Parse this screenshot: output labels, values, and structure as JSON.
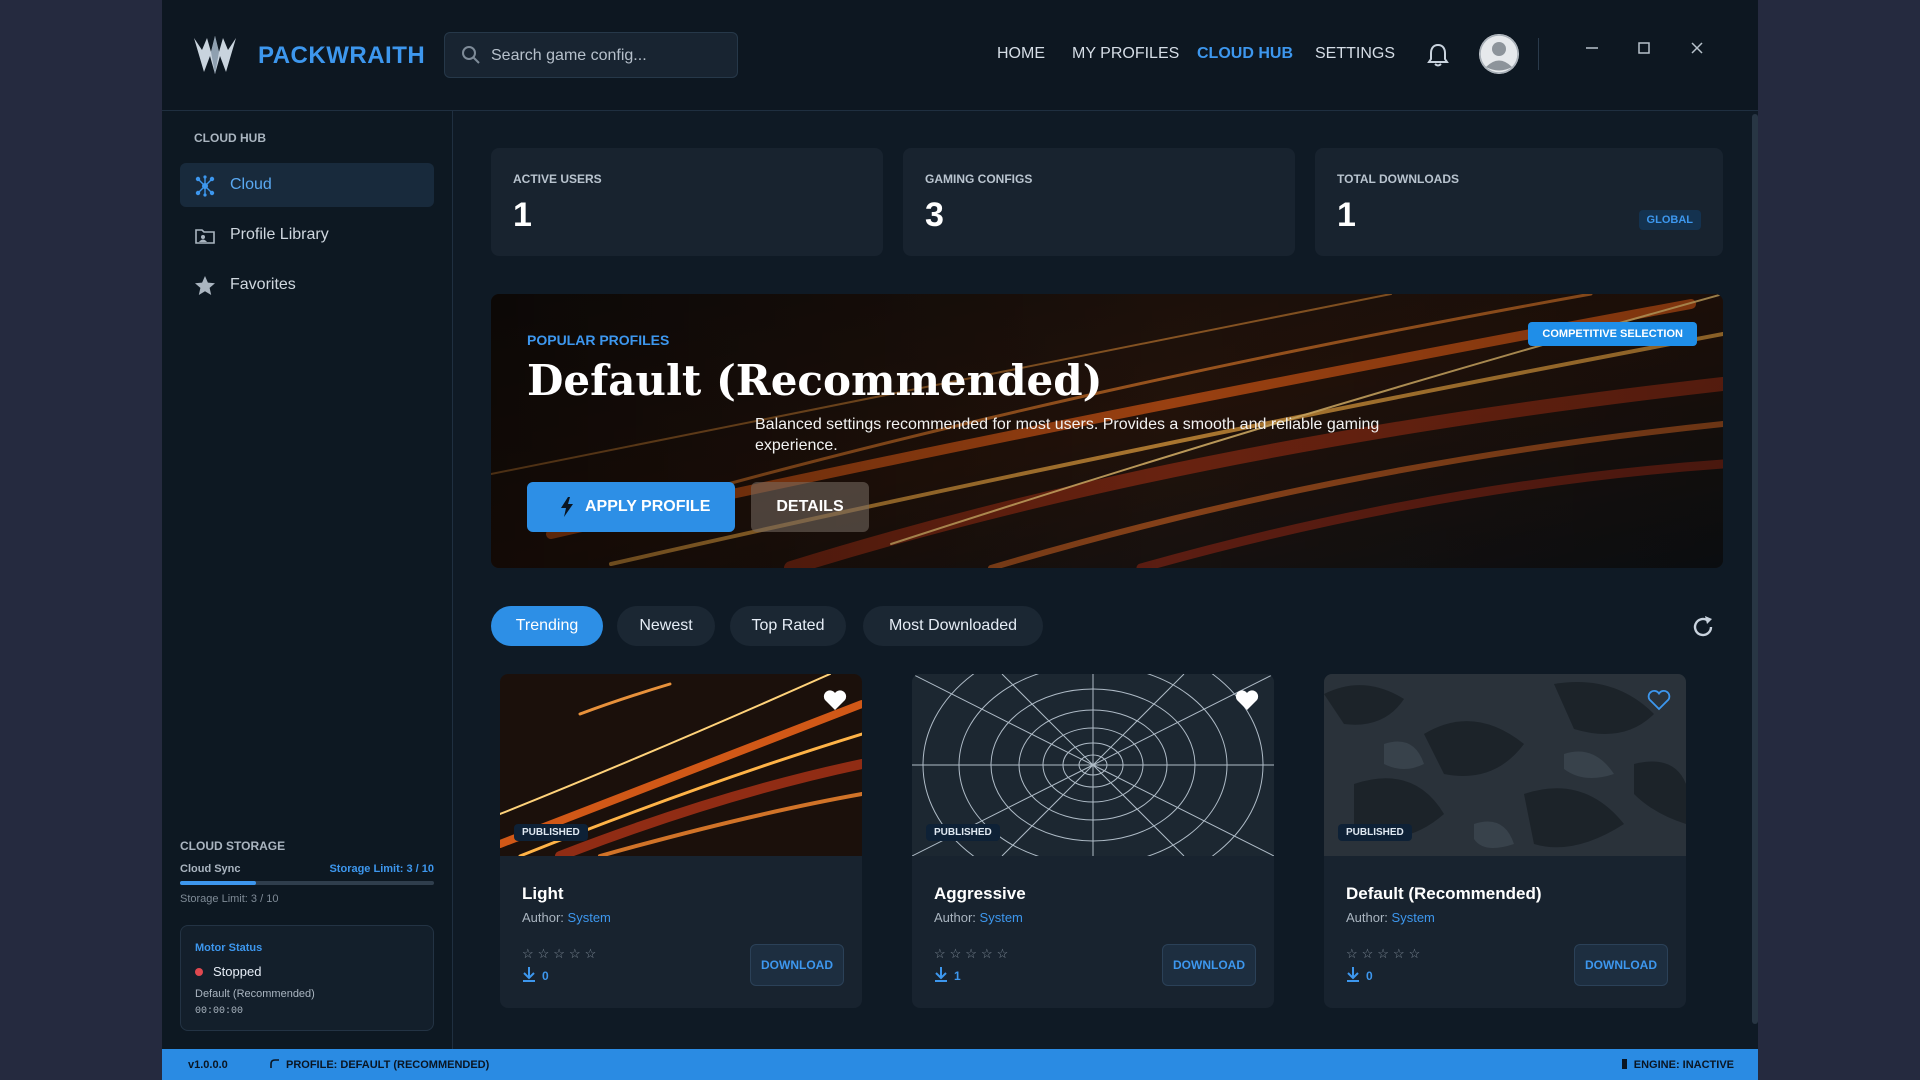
{
  "app": {
    "brand": "PACKWRAITH",
    "search_placeholder": "Search game config...",
    "nav": [
      "HOME",
      "MY PROFILES",
      "CLOUD HUB",
      "SETTINGS"
    ],
    "active_nav": "CLOUD HUB",
    "accent_color": "#3d97ee"
  },
  "sidebar": {
    "heading": "CLOUD HUB",
    "items": [
      {
        "label": "Cloud",
        "icon": "cloud-network-icon",
        "active": true
      },
      {
        "label": "Profile Library",
        "icon": "folder-icon",
        "active": false
      },
      {
        "label": "Favorites",
        "icon": "star-icon",
        "active": false
      }
    ],
    "storage": {
      "title": "CLOUD STORAGE",
      "sync_label": "Cloud Sync",
      "limit_label": "Storage Limit: 3 / 10",
      "used_fraction": 0.3
    },
    "motor": {
      "title": "Motor Status",
      "state": "Stopped",
      "profile": "Default (Recommended)",
      "time": "00:00:00"
    }
  },
  "stats": [
    {
      "label": "ACTIVE USERS",
      "value": "1"
    },
    {
      "label": "GAMING CONFIGS",
      "value": "3"
    },
    {
      "label": "TOTAL DOWNLOADS",
      "value": "1",
      "tag": "GLOBAL"
    }
  ],
  "hero": {
    "eyebrow": "POPULAR PROFILES",
    "title": "Default (Recommended)",
    "description": "Balanced settings recommended for most users. Provides a smooth and reliable gaming experience.",
    "badge": "COMPETITIVE SELECTION",
    "apply_label": "APPLY PROFILE",
    "details_label": "DETAILS"
  },
  "filters": [
    "Trending",
    "Newest",
    "Top Rated",
    "Most Downloaded"
  ],
  "active_filter": "Trending",
  "cards": [
    {
      "name": "Light",
      "author_prefix": "Author:",
      "author": "System",
      "status": "PUBLISHED",
      "downloads": "0",
      "favorited": true,
      "rating": 0,
      "button": "DOWNLOAD",
      "image": "orange-streaks"
    },
    {
      "name": "Aggressive",
      "author_prefix": "Author:",
      "author": "System",
      "status": "PUBLISHED",
      "downloads": "1",
      "favorited": true,
      "rating": 0,
      "button": "DOWNLOAD",
      "image": "spider-web"
    },
    {
      "name": "Default (Recommended)",
      "author_prefix": "Author:",
      "author": "System",
      "status": "PUBLISHED",
      "downloads": "0",
      "favorited": false,
      "rating": 0,
      "button": "DOWNLOAD",
      "image": "dark-camo"
    }
  ],
  "footer": {
    "version": "v1.0.0.0",
    "profile": "PROFILE: DEFAULT (RECOMMENDED)",
    "engine": "ENGINE: INACTIVE"
  }
}
